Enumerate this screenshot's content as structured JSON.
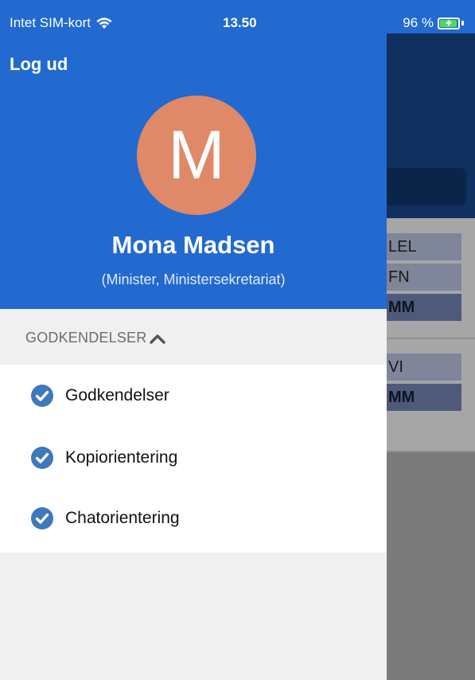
{
  "status_bar": {
    "carrier": "Intet SIM-kort",
    "time": "13.50",
    "battery_percent": "96 %",
    "battery_level": 0.96
  },
  "drawer": {
    "logout_label": "Log ud",
    "avatar_initial": "M",
    "avatar_color": "#df8968",
    "user_name": "Mona Madsen",
    "user_role": "(Minister, Ministersekretariat)",
    "section_label": "GODKENDELSER",
    "items": [
      {
        "label": "Godkendelser",
        "icon": "check-circle-icon"
      },
      {
        "label": "Kopiorientering",
        "icon": "check-circle-icon"
      },
      {
        "label": "Chatorientering",
        "icon": "check-circle-icon"
      }
    ]
  },
  "background": {
    "cells_group1": [
      "LEL",
      "FN",
      "MM"
    ],
    "cells_group2": [
      "VI",
      "MM"
    ]
  },
  "colors": {
    "header_blue": "#2269d0",
    "check_blue": "#3e78bd"
  }
}
